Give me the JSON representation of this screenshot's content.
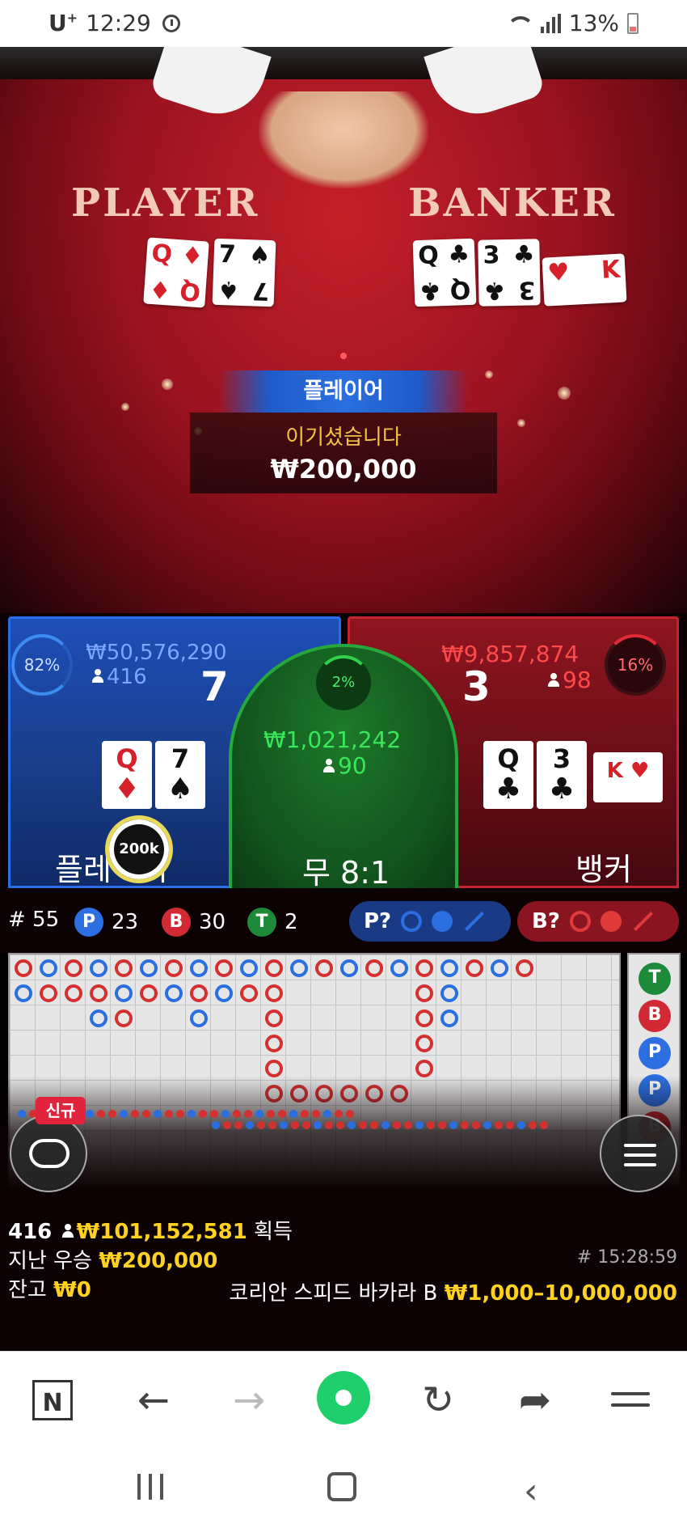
{
  "status_bar": {
    "carrier": "U",
    "carrier_sup": "+",
    "time": "12:29",
    "battery": "13%"
  },
  "video": {
    "player_label": "PLAYER",
    "banker_label": "BANKER",
    "player_cards": [
      {
        "rank": "Q",
        "suit": "♦",
        "color": "red"
      },
      {
        "rank": "7",
        "suit": "♠",
        "color": "black"
      }
    ],
    "banker_cards": [
      {
        "rank": "Q",
        "suit": "♣",
        "color": "black"
      },
      {
        "rank": "3",
        "suit": "♣",
        "color": "black"
      },
      {
        "rank": "K",
        "suit": "♥",
        "color": "red"
      }
    ],
    "win_banner": "플레이어",
    "win_text": "이기셨습니다",
    "win_amount": "₩200,000"
  },
  "bet_panel": {
    "player": {
      "percent": "82%",
      "amount": "₩50,576,290",
      "count": "416",
      "score": "7",
      "label": "플레이어",
      "cards": [
        {
          "rank": "Q",
          "suit": "♦",
          "color": "red"
        },
        {
          "rank": "7",
          "suit": "♠",
          "color": "black"
        }
      ],
      "chip": "200k"
    },
    "tie": {
      "percent": "2%",
      "amount": "₩1,021,242",
      "count": "90",
      "label": "무 8:1"
    },
    "banker": {
      "percent": "16%",
      "amount": "₩9,857,874",
      "count": "98",
      "score": "3",
      "label": "뱅커",
      "cards": [
        {
          "rank": "Q",
          "suit": "♣",
          "color": "black"
        },
        {
          "rank": "3",
          "suit": "♣",
          "color": "black"
        },
        {
          "rank": "K",
          "suit": "♥",
          "color": "red"
        }
      ]
    }
  },
  "stats": {
    "shoe": "# 55",
    "player_letter": "P",
    "player_wins": "23",
    "banker_letter": "B",
    "banker_wins": "30",
    "tie_letter": "T",
    "tie_wins": "2",
    "player_predict": "P?",
    "banker_predict": "B?",
    "colors": {
      "player": "#2d6fe0",
      "banker": "#d12a35",
      "tie": "#1d8a3a"
    }
  },
  "road": {
    "side_letters": [
      "T",
      "B",
      "P",
      "P",
      "B"
    ]
  },
  "chat": {
    "new_badge": "신규"
  },
  "info": {
    "players": "416",
    "total_won": "₩101,152,581",
    "won_suffix": "획득",
    "last_win_label": "지난 우승",
    "last_win_amount": "₩200,000",
    "balance_label": "잔고",
    "balance_amount": "₩0",
    "game_time": "# 15:28:59",
    "table_name": "코리안 스피드 바카라 B",
    "table_limits": "₩1,000–10,000,000"
  },
  "browser": {
    "naver_icon": "N"
  }
}
